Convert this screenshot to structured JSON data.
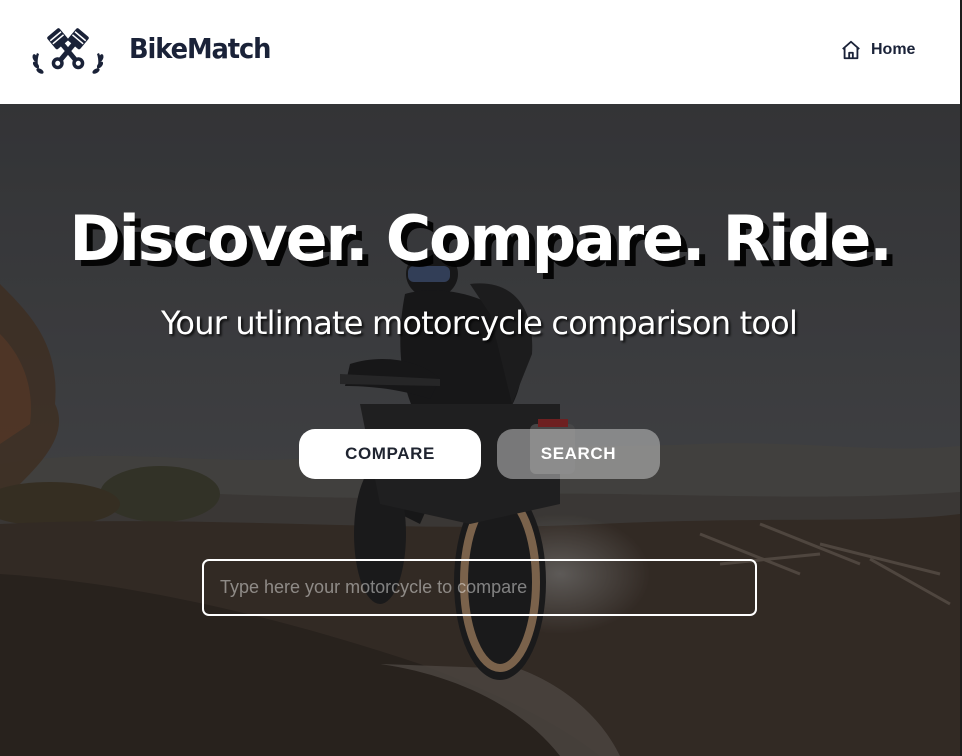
{
  "header": {
    "brand": "BikeMatch",
    "nav": {
      "home_label": "Home"
    }
  },
  "hero": {
    "title": "Discover. Compare. Ride.",
    "subtitle": "Your utlimate motorcycle comparison tool",
    "buttons": {
      "compare_label": "COMPARE",
      "search_label": "SEARCH"
    },
    "search": {
      "placeholder": "Type here your motorcycle to compare",
      "value": ""
    }
  },
  "icons": {
    "logo": "crossed-pistons-laurel-icon",
    "home": "home-icon"
  },
  "colors": {
    "brand": "#1a2238",
    "hero_overlay": "#2a2b2d",
    "button_light": "#ffffff"
  }
}
